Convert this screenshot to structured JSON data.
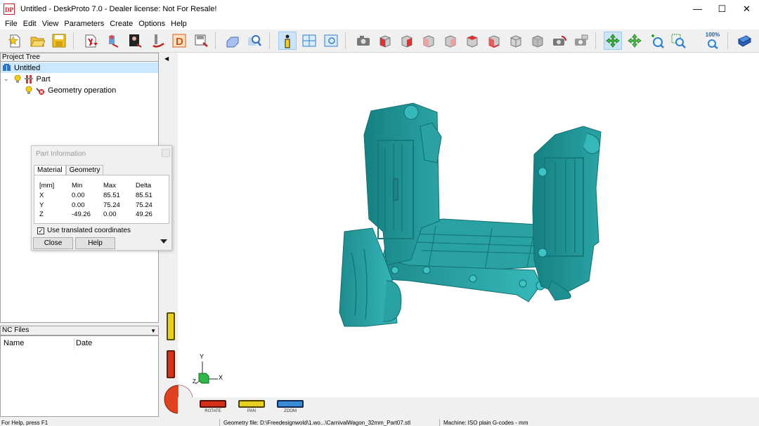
{
  "window": {
    "logo_text": "DP",
    "title": "Untitled - DeskProto 7.0 - Dealer license: Not For Resale!",
    "minimize": "—",
    "maximize": "☐",
    "close": "✕"
  },
  "menu": [
    "File",
    "Edit",
    "View",
    "Parameters",
    "Create",
    "Options",
    "Help"
  ],
  "toolbar_icons": [
    "new-file-icon",
    "open-folder-icon",
    "save-icon",
    "import-geometry-icon",
    "import-vector-icon",
    "import-bitmap-icon",
    "toolpath-icon",
    "d-icon",
    "export-icon",
    "part-settings-icon",
    "search-geometry-icon",
    "info-icon",
    "layout-icon",
    "preview-icon",
    "camera-icon",
    "cube-front-icon",
    "cube-right-icon",
    "cube-back-icon",
    "cube-left-icon",
    "cube-top-icon",
    "cube-bottom-icon",
    "cube-iso-icon",
    "cube-iso2-icon",
    "camera-rotate-icon",
    "camera-pan-icon",
    "rotate-view-icon",
    "pan-view-icon",
    "zoom-in-icon",
    "zoom-window-icon",
    "zoom-100-icon",
    "book-icon"
  ],
  "zoom_badge": "100%",
  "project_tree": {
    "header": "Project Tree",
    "root": "Untitled",
    "part": "Part",
    "operation": "Geometry operation"
  },
  "nc_files": {
    "header": "NC Files",
    "col_name": "Name",
    "col_date": "Date"
  },
  "part_info": {
    "title": "Part Information",
    "tabs": [
      "Material",
      "Geometry"
    ],
    "headers": [
      "[mm]",
      "Min",
      "Max",
      "Delta"
    ],
    "rows": [
      [
        "X",
        "0.00",
        "85.51",
        "85.51"
      ],
      [
        "Y",
        "0.00",
        "75.24",
        "75.24"
      ],
      [
        "Z",
        "-49.26",
        "0.00",
        "49.26"
      ]
    ],
    "checkbox_label": "Use translated coordinates",
    "checkbox_checked": true,
    "close_button": "Close",
    "help_button": "Help"
  },
  "viewport": {
    "axis_y": "Y",
    "axis_x": "X",
    "axis_z": "Z",
    "rotate_label": "ROTATE",
    "pan_label": "PAN",
    "zoom_label": "ZOOM",
    "model_color": "#2ca6a8"
  },
  "status": {
    "help": "For Help, press F1",
    "geometry": "Geometry file: D:\\Freedesignwold\\1.wo...\\CarnivalWagon_32mm_Part07.stl",
    "machine": "Machine: ISO plain G-codes - mm"
  }
}
